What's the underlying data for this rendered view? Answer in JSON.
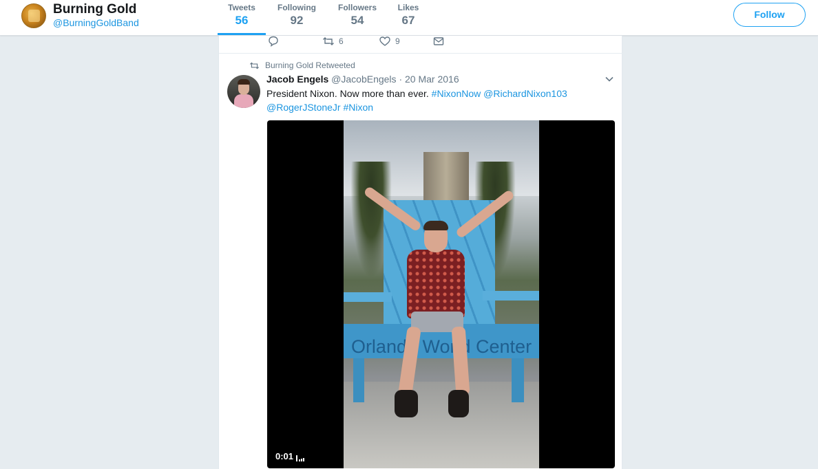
{
  "profile": {
    "name": "Burning Gold",
    "handle": "@BurningGoldBand",
    "follow_label": "Follow"
  },
  "stats": [
    {
      "label": "Tweets",
      "value": "56"
    },
    {
      "label": "Following",
      "value": "92"
    },
    {
      "label": "Followers",
      "value": "54"
    },
    {
      "label": "Likes",
      "value": "67"
    }
  ],
  "prev_tweet_actions": {
    "retweets": "6",
    "likes": "9"
  },
  "tweet": {
    "retweet_context": "Burning Gold Retweeted",
    "author_name": "Jacob Engels",
    "author_handle": "@JacobEngels",
    "separator": "·",
    "date": "20 Mar 2016",
    "text_plain": "President Nixon. Now more than ever.",
    "links": [
      "#NixonNow",
      "@RichardNixon103",
      "@RogerJStoneJr",
      "#Nixon"
    ],
    "video_timestamp": "0:01",
    "video_sign": "Orlando World Center"
  },
  "colors": {
    "accent": "#1da1f2",
    "link": "#1b95e0",
    "muted": "#657786",
    "background": "#e6ecf0"
  }
}
